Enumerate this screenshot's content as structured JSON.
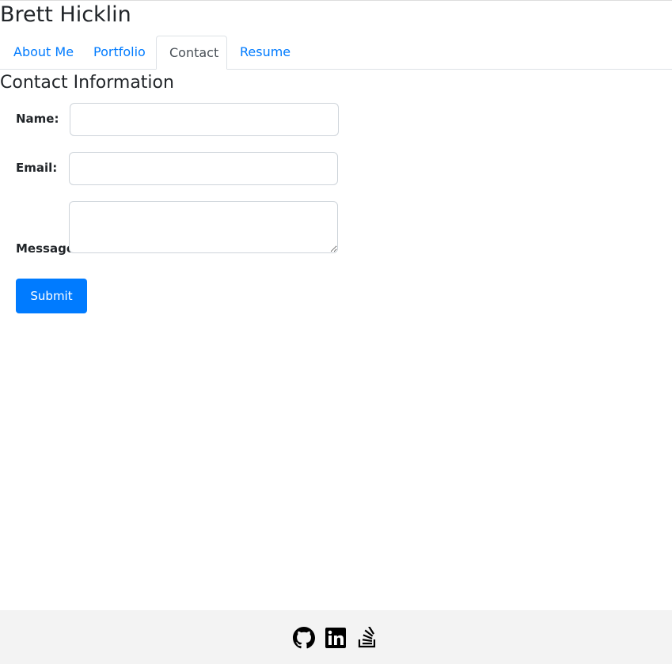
{
  "header": {
    "title": "Brett Hicklin"
  },
  "nav": {
    "tabs": [
      {
        "label": "About Me",
        "active": false
      },
      {
        "label": "Portfolio",
        "active": false
      },
      {
        "label": "Contact",
        "active": true
      },
      {
        "label": "Resume",
        "active": false
      }
    ]
  },
  "contact": {
    "heading": "Contact Information",
    "fields": {
      "name_label": "Name:",
      "name_value": "",
      "email_label": "Email:",
      "email_value": "",
      "message_label": "Message:",
      "message_value": ""
    },
    "submit_label": "Submit"
  },
  "footer": {
    "icons": [
      "github-icon",
      "linkedin-icon",
      "stackoverflow-icon"
    ]
  },
  "colors": {
    "link": "#007bff",
    "active_tab_text": "#495057",
    "button_bg": "#007bff",
    "footer_bg": "#f3f3f3",
    "text": "#212529"
  }
}
